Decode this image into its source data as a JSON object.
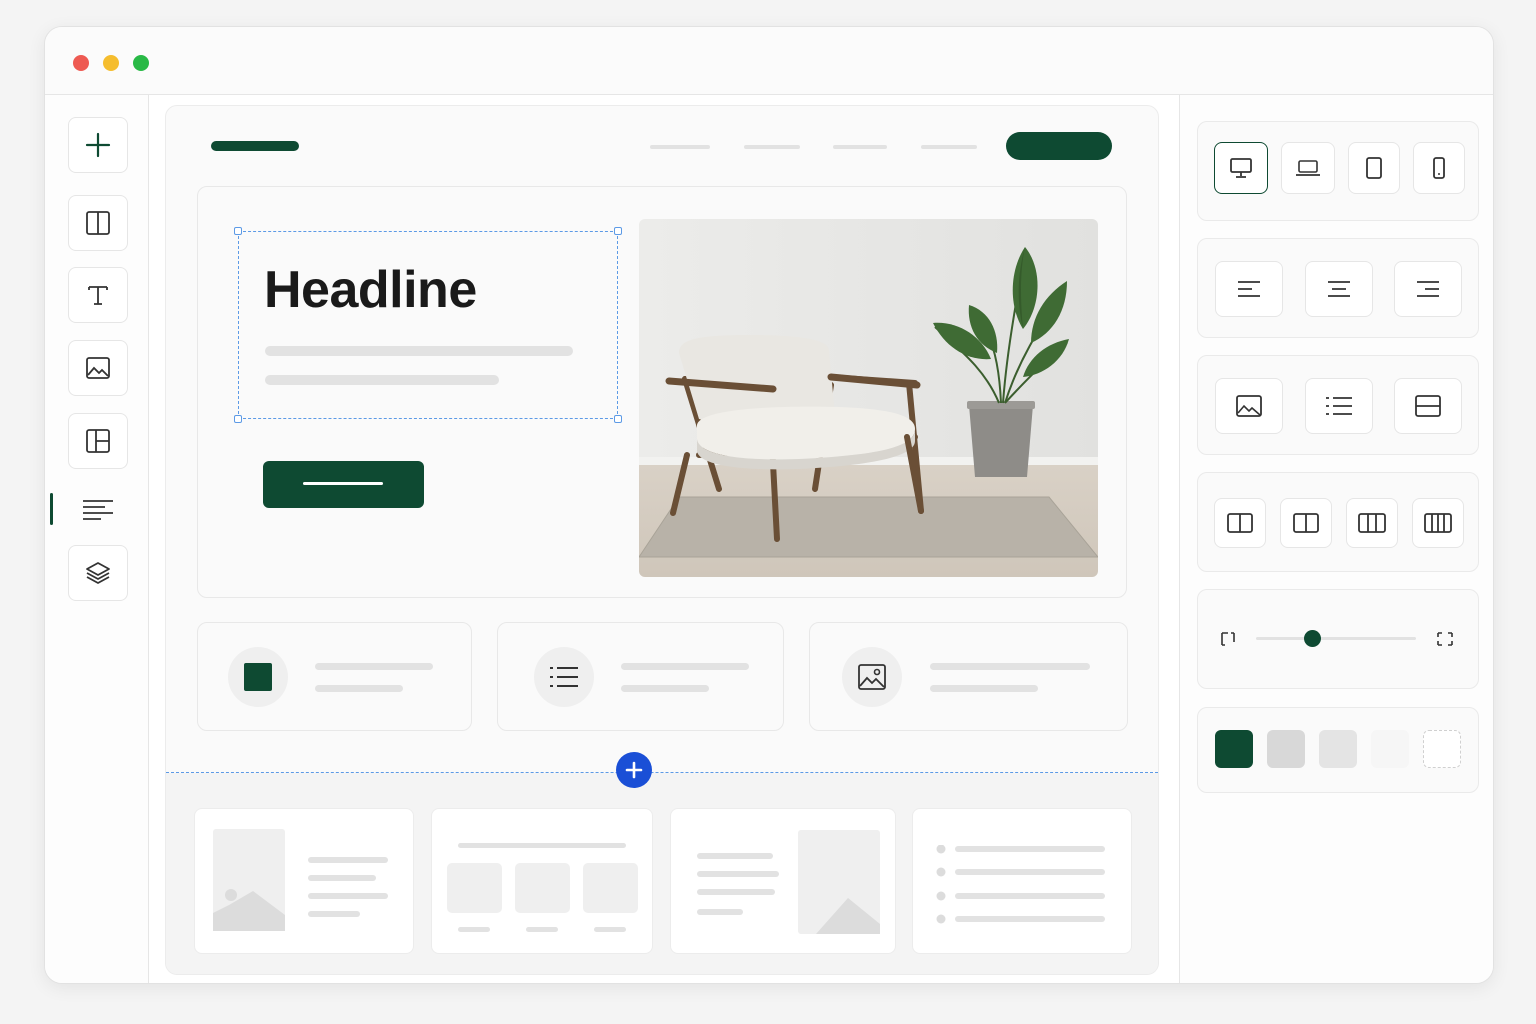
{
  "colors": {
    "brand_green": "#0e4a32",
    "accent_blue": "#1a4fd6",
    "selection_blue": "#5c9ae6",
    "skeleton_gray": "#e2e2e2",
    "window_red": "#ee5a52",
    "window_yellow": "#f5bd2e",
    "window_green": "#29b946"
  },
  "window": {
    "controls": [
      "close",
      "minimize",
      "maximize"
    ]
  },
  "left_toolbar": {
    "tools": [
      {
        "icon": "plus-icon",
        "active": false
      },
      {
        "icon": "columns-icon",
        "active": false
      },
      {
        "icon": "text-icon",
        "active": false
      },
      {
        "icon": "image-icon",
        "active": false
      },
      {
        "icon": "layout-icon",
        "active": false
      },
      {
        "icon": "align-left-icon",
        "active": true
      },
      {
        "icon": "layers-icon",
        "active": false
      }
    ]
  },
  "canvas": {
    "hero": {
      "headline": "Headline",
      "image": "armchair-and-plant-photo"
    },
    "features": [
      {
        "icon": "square-icon"
      },
      {
        "icon": "list-icon"
      },
      {
        "icon": "image-icon"
      }
    ],
    "add_section_icon": "plus-icon",
    "templates": [
      "image-left-text",
      "three-cards",
      "text-image-right",
      "bullet-list"
    ]
  },
  "right_panel": {
    "devices": [
      {
        "icon": "desktop-icon",
        "active": true
      },
      {
        "icon": "laptop-icon",
        "active": false
      },
      {
        "icon": "tablet-icon",
        "active": false
      },
      {
        "icon": "phone-icon",
        "active": false
      }
    ],
    "alignment": [
      "align-left-icon",
      "align-center-icon",
      "align-right-icon"
    ],
    "blocks": [
      "image-block-icon",
      "list-block-icon",
      "split-block-icon"
    ],
    "column_layouts": [
      "two-columns-icon",
      "two-columns-split-icon",
      "three-columns-icon",
      "four-columns-icon"
    ],
    "size_slider": {
      "level": 0.35,
      "min_icon": "shrink-icon",
      "max_icon": "expand-icon"
    },
    "swatches": [
      "#0e4a32",
      "#d8d8d8",
      "#e4e4e4",
      "#f6f6f6",
      "#ffffff"
    ]
  }
}
